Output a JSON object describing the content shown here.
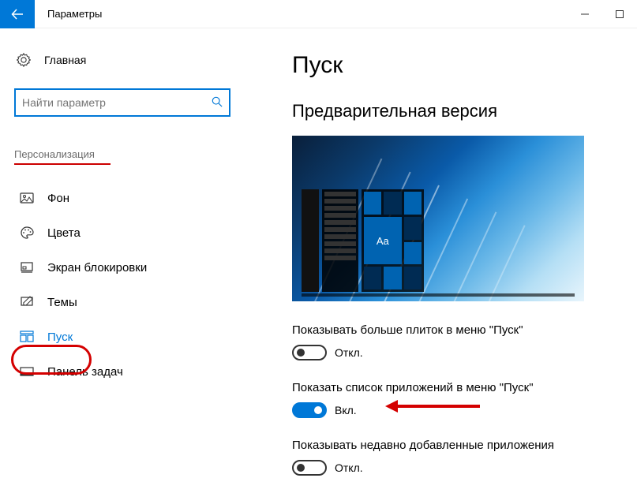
{
  "window": {
    "title": "Параметры"
  },
  "sidebar": {
    "home": "Главная",
    "search_placeholder": "Найти параметр",
    "section": "Персонализация",
    "items": [
      {
        "label": "Фон"
      },
      {
        "label": "Цвета"
      },
      {
        "label": "Экран блокировки"
      },
      {
        "label": "Темы"
      },
      {
        "label": "Пуск"
      },
      {
        "label": "Панель задач"
      }
    ]
  },
  "main": {
    "heading": "Пуск",
    "subheading": "Предварительная версия",
    "preview_tile_text": "Aa",
    "options": [
      {
        "label": "Показывать больше плиток в меню \"Пуск\"",
        "state": "Откл.",
        "on": false
      },
      {
        "label": "Показать список приложений в меню \"Пуск\"",
        "state": "Вкл.",
        "on": true
      },
      {
        "label": "Показывать недавно добавленные приложения",
        "state": "Откл.",
        "on": false
      }
    ]
  }
}
